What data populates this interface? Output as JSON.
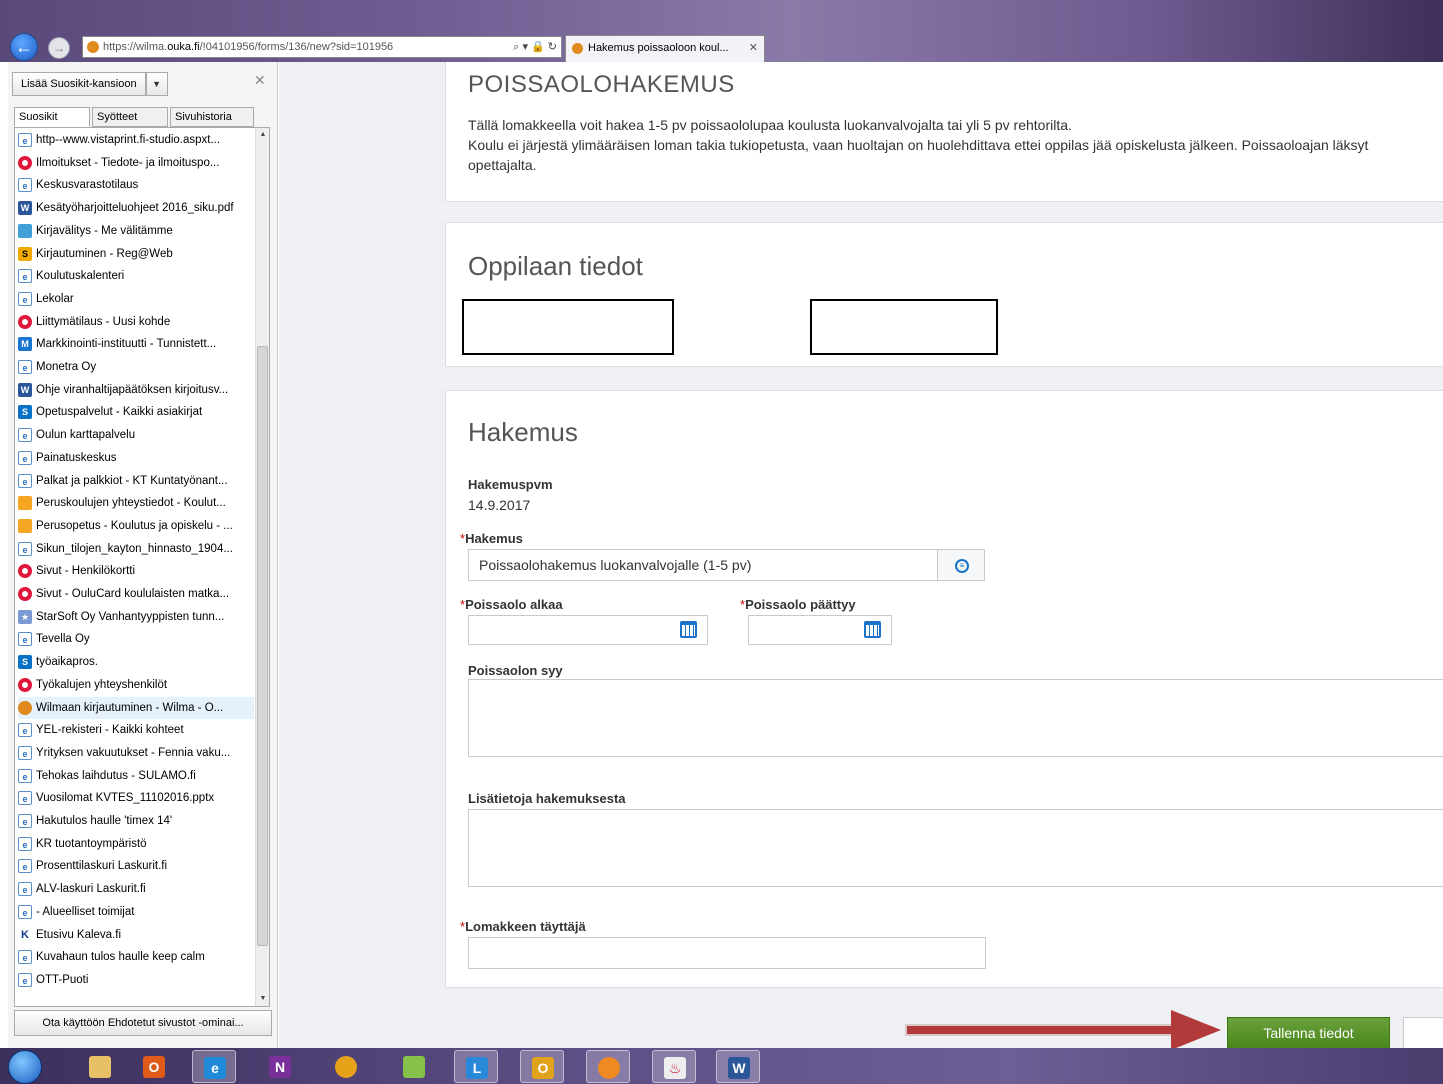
{
  "browser": {
    "url_prefix": "https://wilma.",
    "url_domain": "ouka.fi",
    "url_path": "/!04101956/forms/136/new?sid=101956",
    "address_tools": "⌕ ▾ 🔒 ↻",
    "tab_title": "Hakemus poissaoloon koul...",
    "tab_close": "✕",
    "back_glyph": "←",
    "forward_glyph": "→"
  },
  "favorites": {
    "add_button": "Lisää Suosikit-kansioon",
    "dropdown_glyph": "▼",
    "close": "✕",
    "tabs": [
      "Suosikit",
      "Syötteet",
      "Sivuhistoria"
    ],
    "items": [
      {
        "label": "http--www.vistaprint.fi-studio.aspxt...",
        "icon": "ie-page-icon"
      },
      {
        "label": "Ilmoitukset - Tiedote- ja ilmoituspo...",
        "icon": "ring-icon"
      },
      {
        "label": "Keskusvarastotilaus",
        "icon": "ie-page-icon"
      },
      {
        "label": "Kesätyöharjoitteluohjeet 2016_siku.pdf",
        "icon": "word-icon"
      },
      {
        "label": "Kirjavälitys - Me välitämme",
        "icon": "book-icon"
      },
      {
        "label": "Kirjautuminen - Reg@Web",
        "icon": "s-icon"
      },
      {
        "label": "Koulutuskalenteri",
        "icon": "ie-page-icon"
      },
      {
        "label": "Lekolar",
        "icon": "ie-page-icon"
      },
      {
        "label": "Liittymätilaus - Uusi kohde",
        "icon": "ring-icon"
      },
      {
        "label": "Markkinointi-instituutti - Tunnistett...",
        "icon": "building-icon"
      },
      {
        "label": "Monetra Oy",
        "icon": "ie-page-icon"
      },
      {
        "label": "Ohje viranhaltijapäätöksen kirjoitusv...",
        "icon": "word-icon"
      },
      {
        "label": "Opetuspalvelut - Kaikki asiakirjat",
        "icon": "sharepoint-icon"
      },
      {
        "label": "Oulun karttapalvelu",
        "icon": "ie-page-icon"
      },
      {
        "label": "Painatuskeskus",
        "icon": "ie-page-icon"
      },
      {
        "label": "Palkat ja palkkiot - KT Kuntatyönant...",
        "icon": "ie-page-icon"
      },
      {
        "label": "Peruskoulujen yhteystiedot - Koulut...",
        "icon": "ouka-icon"
      },
      {
        "label": "Perusopetus - Koulutus ja opiskelu - ...",
        "icon": "ouka-icon"
      },
      {
        "label": "Sikun_tilojen_kayton_hinnasto_1904...",
        "icon": "ie-page-icon"
      },
      {
        "label": "Sivut - Henkilökortti",
        "icon": "ring-icon"
      },
      {
        "label": "Sivut - OuluCard koululaisten matka...",
        "icon": "ring-icon"
      },
      {
        "label": "StarSoft Oy  Vanhantyyppisten tunn...",
        "icon": "star-icon"
      },
      {
        "label": "Tevella Oy",
        "icon": "ie-page-icon"
      },
      {
        "label": "työaikapros.",
        "icon": "sharepoint-icon"
      },
      {
        "label": "Työkalujen yhteyshenkilöt",
        "icon": "ring-icon"
      },
      {
        "label": "Wilmaan kirjautuminen - Wilma - O...",
        "icon": "wilma-icon"
      },
      {
        "label": "YEL-rekisteri - Kaikki kohteet",
        "icon": "ie-page-icon"
      },
      {
        "label": "Yrityksen vakuutukset - Fennia vaku...",
        "icon": "ie-page-icon"
      },
      {
        "label": "Tehokas laihdutus - SULAMO.fi",
        "icon": "ie-page-icon"
      },
      {
        "label": "Vuosilomat KVTES_11102016.pptx",
        "icon": "ie-page-icon"
      },
      {
        "label": "Hakutulos haulle 'timex 14'",
        "icon": "ie-page-icon"
      },
      {
        "label": "KR tuotantoympäristö",
        "icon": "ie-page-icon"
      },
      {
        "label": "Prosenttilaskuri  Laskurit.fi",
        "icon": "ie-page-icon"
      },
      {
        "label": "ALV-laskuri  Laskurit.fi",
        "icon": "ie-page-icon"
      },
      {
        "label": "- Alueelliset toimijat",
        "icon": "ie-page-icon"
      },
      {
        "label": "Etusivu  Kaleva.fi",
        "icon": "kaleva-icon"
      },
      {
        "label": "Kuvahaun tulos haulle keep calm",
        "icon": "ie-page-icon"
      },
      {
        "label": "OTT-Puoti",
        "icon": "ie-page-icon"
      }
    ],
    "suggest_button": "Ota käyttöön Ehdotetut sivustot -ominai..."
  },
  "form": {
    "title": "POISSAOLOHAKEMUS",
    "intro_line1": "Tällä lomakkeella voit hakea 1-5 pv poissaololupaa koulusta luokanvalvojalta tai yli 5 pv rehtorilta.",
    "intro_line2": "Koulu ei järjestä ylimääräisen loman takia tukiopetusta, vaan huoltajan on huolehdittava ettei oppilas jää opiskelusta jälkeen. Poissaoloajan läksyt",
    "intro_line3": "opettajalta.",
    "student_title": "Oppilaan tiedot",
    "application_title": "Hakemus",
    "date_label": "Hakemuspvm",
    "date_value": "14.9.2017",
    "required_mark": "*",
    "application_label": "Hakemus",
    "application_value": "Poissaolohakemus luokanvalvojalle (1-5 pv)",
    "absence_start_label": "Poissaolo alkaa",
    "absence_end_label": "Poissaolo päättyy",
    "reason_label": "Poissaolon syy",
    "extra_label": "Lisätietoja hakemuksesta",
    "filler_label": "Lomakkeen täyttäjä",
    "save_button": "Tallenna tiedot"
  },
  "taskbar": {
    "items": [
      "start-icon",
      "file-explorer-icon",
      "outlook-icon",
      "internet-explorer-icon",
      "onenote-icon",
      "chrome-icon",
      "folder-icon",
      "lync-icon",
      "outlook-mail-icon",
      "wilma-icon",
      "java-icon",
      "word-icon"
    ]
  },
  "colors": {
    "save_button": "#5a9a2a",
    "annotation_arrow": "#b33a3a",
    "required": "#cc0000"
  }
}
